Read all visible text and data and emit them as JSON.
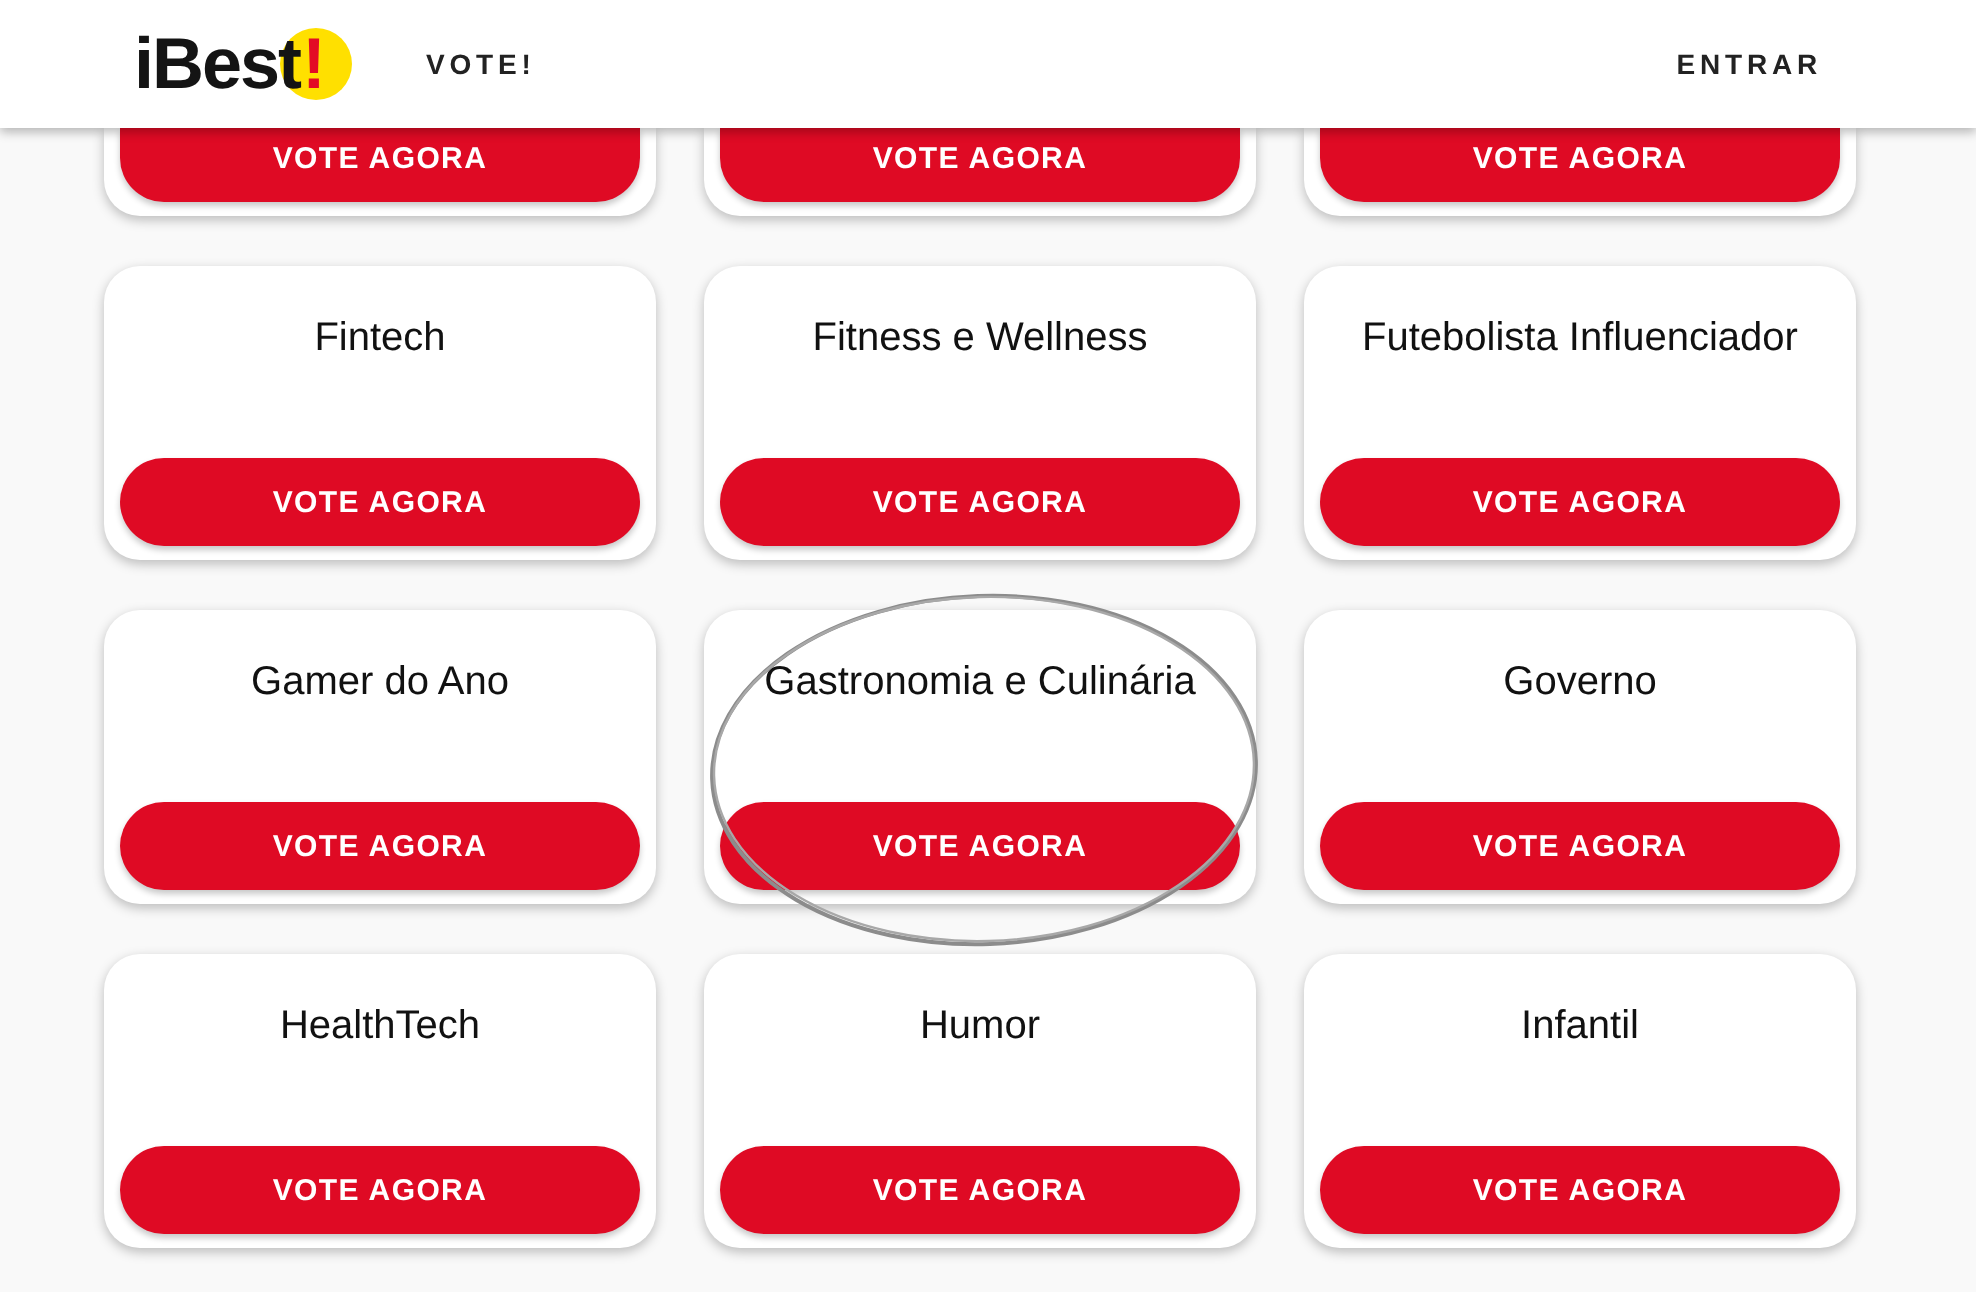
{
  "header": {
    "logo": {
      "text": "iBest",
      "mark": "!"
    },
    "nav_link": "VOTE!",
    "login_link": "ENTRAR"
  },
  "cards": [
    {
      "kind": "clipped",
      "button": "VOTE AGORA",
      "circled": false
    },
    {
      "kind": "clipped",
      "button": "VOTE AGORA",
      "circled": false
    },
    {
      "kind": "clipped",
      "button": "VOTE AGORA",
      "circled": false
    },
    {
      "kind": "full",
      "title": "Fintech",
      "button": "VOTE AGORA",
      "circled": false
    },
    {
      "kind": "full",
      "title": "Fitness e Wellness",
      "button": "VOTE AGORA",
      "circled": false
    },
    {
      "kind": "full",
      "title": "Futebolista Influenciador",
      "button": "VOTE AGORA",
      "circled": false
    },
    {
      "kind": "full",
      "title": "Gamer do Ano",
      "button": "VOTE AGORA",
      "circled": false
    },
    {
      "kind": "full",
      "title": "Gastronomia e Culinária",
      "button": "VOTE AGORA",
      "circled": true
    },
    {
      "kind": "full",
      "title": "Governo",
      "button": "VOTE AGORA",
      "circled": false
    },
    {
      "kind": "full",
      "title": "HealthTech",
      "button": "VOTE AGORA",
      "circled": false
    },
    {
      "kind": "full",
      "title": "Humor",
      "button": "VOTE AGORA",
      "circled": false
    },
    {
      "kind": "full",
      "title": "Infantil",
      "button": "VOTE AGORA",
      "circled": false
    }
  ]
}
